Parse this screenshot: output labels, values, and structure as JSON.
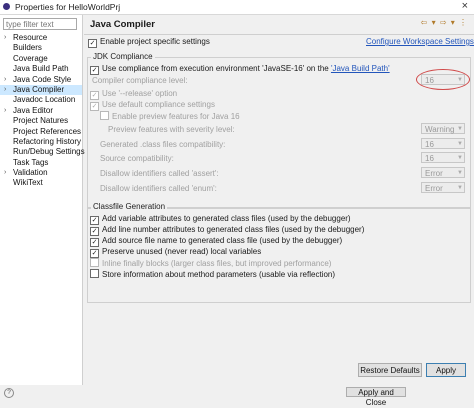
{
  "window": {
    "title": "Properties for HelloWorldPrj",
    "close_glyph": "×"
  },
  "filter": {
    "placeholder": "type filter text"
  },
  "tree": [
    {
      "label": "Resource",
      "expandable": true
    },
    {
      "label": "Builders",
      "expandable": false
    },
    {
      "label": "Coverage",
      "expandable": false
    },
    {
      "label": "Java Build Path",
      "expandable": false
    },
    {
      "label": "Java Code Style",
      "expandable": true
    },
    {
      "label": "Java Compiler",
      "expandable": true,
      "selected": true
    },
    {
      "label": "Javadoc Location",
      "expandable": false
    },
    {
      "label": "Java Editor",
      "expandable": true
    },
    {
      "label": "Project Natures",
      "expandable": false
    },
    {
      "label": "Project References",
      "expandable": false
    },
    {
      "label": "Refactoring History",
      "expandable": false
    },
    {
      "label": "Run/Debug Settings",
      "expandable": false
    },
    {
      "label": "Task Tags",
      "expandable": false
    },
    {
      "label": "Validation",
      "expandable": true
    },
    {
      "label": "WikiText",
      "expandable": false
    }
  ],
  "page": {
    "title": "Java Compiler",
    "nav_glyphs": "⇦ ▾ ⇨ ▾ ⋮",
    "enable_specific": "Enable project specific settings",
    "configure_link": "Configure Workspace Settings..."
  },
  "jdk": {
    "group_label": "JDK Compliance",
    "use_env_prefix": "Use compliance from execution environment 'JavaSE-16' on the ",
    "use_env_link": "'Java Build Path'",
    "compliance_label": "Compiler compliance level:",
    "compliance_value": "16",
    "use_release": "Use '--release' option",
    "use_default": "Use default compliance settings",
    "enable_preview": "Enable preview features for Java 16",
    "preview_severity_label": "Preview features with severity level:",
    "preview_severity_value": "Warning",
    "generated_label": "Generated .class files compatibility:",
    "generated_value": "16",
    "source_label": "Source compatibility:",
    "source_value": "16",
    "assert_label": "Disallow identifiers called 'assert':",
    "assert_value": "Error",
    "enum_label": "Disallow identifiers called 'enum':",
    "enum_value": "Error"
  },
  "classfile": {
    "group_label": "Classfile Generation",
    "options": [
      {
        "label": "Add variable attributes to generated class files (used by the debugger)",
        "checked": true,
        "enabled": true
      },
      {
        "label": "Add line number attributes to generated class files (used by the debugger)",
        "checked": true,
        "enabled": true
      },
      {
        "label": "Add source file name to generated class file (used by the debugger)",
        "checked": true,
        "enabled": true
      },
      {
        "label": "Preserve unused (never read) local variables",
        "checked": true,
        "enabled": true
      },
      {
        "label": "Inline finally blocks (larger class files, but improved performance)",
        "checked": false,
        "enabled": false
      },
      {
        "label": "Store information about method parameters (usable via reflection)",
        "checked": false,
        "enabled": true
      }
    ]
  },
  "buttons": {
    "restore_defaults": "Restore Defaults",
    "apply": "Apply",
    "apply_close": "Apply and Close"
  },
  "help_glyph": "?",
  "check_glyph": "✓"
}
